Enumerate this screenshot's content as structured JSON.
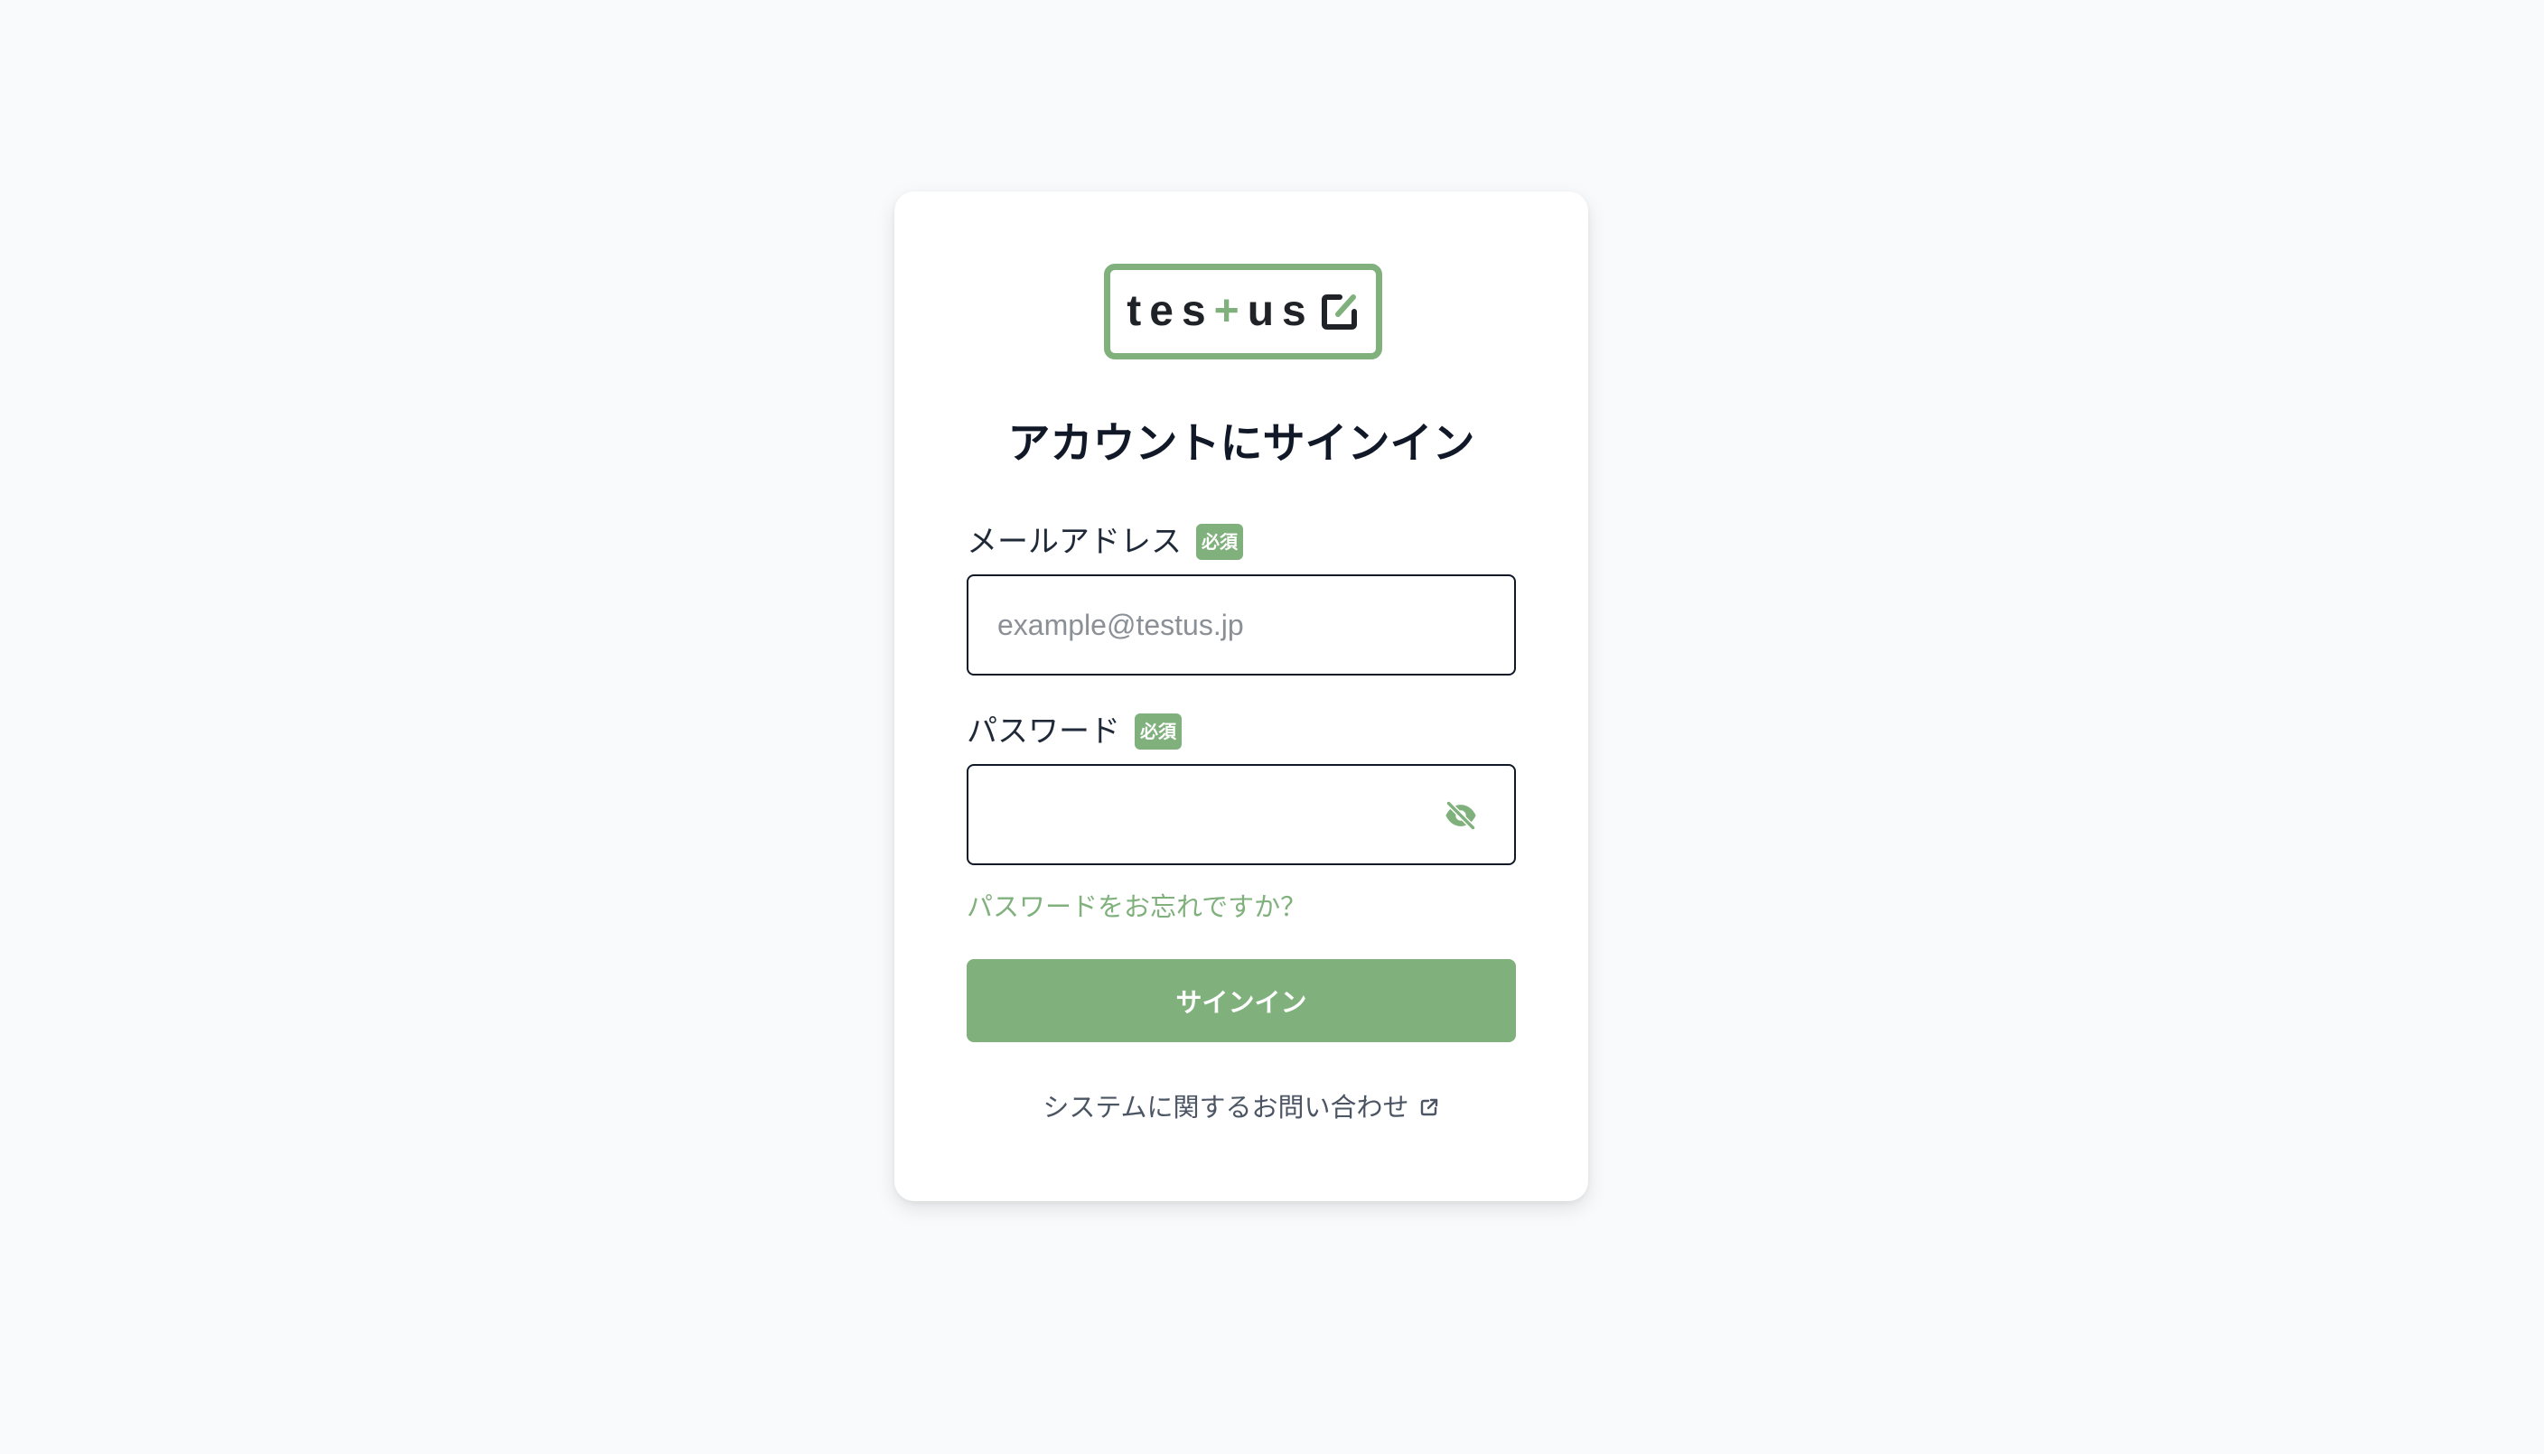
{
  "logo": {
    "text_before": "tes",
    "plus": "+",
    "text_after": "us",
    "icon": "checkbox-pen-icon",
    "brand_color": "#80b17d"
  },
  "title": "アカウントにサインイン",
  "email": {
    "label": "メールアドレス",
    "required_badge": "必須",
    "placeholder": "example@testus.jp",
    "value": ""
  },
  "password": {
    "label": "パスワード",
    "required_badge": "必須",
    "value": "",
    "toggle_icon": "eye-off-icon"
  },
  "forgot_password_link": "パスワードをお忘れですか？",
  "signin_button": "サインイン",
  "contact_link": {
    "label": "システムに関するお問い合わせ",
    "icon": "external-link-icon"
  },
  "colors": {
    "accent": "#80b17d",
    "background": "#f9fafb",
    "card": "#ffffff",
    "text": "#111827"
  }
}
